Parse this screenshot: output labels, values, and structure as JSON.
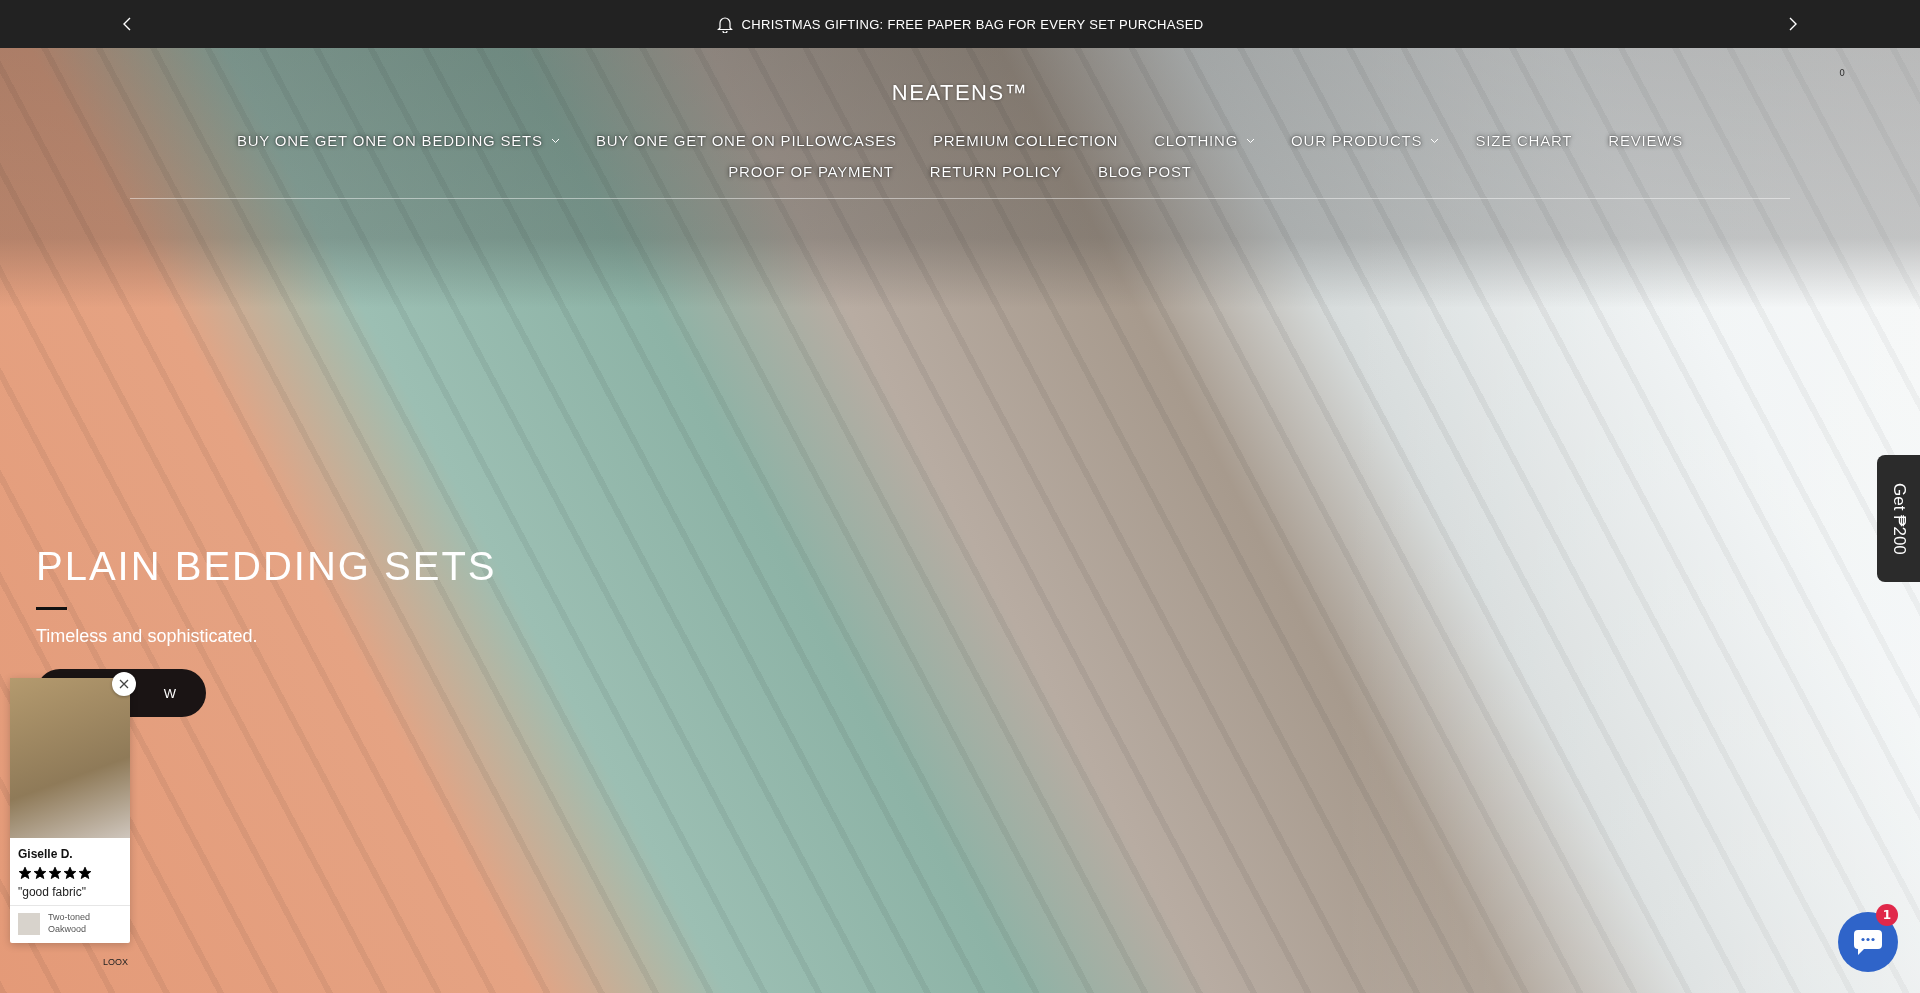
{
  "announcement": {
    "text": "CHRISTMAS GIFTING: FREE PAPER BAG FOR EVERY SET PURCHASED"
  },
  "header": {
    "logo": "NEATENS™",
    "cart_count": "0"
  },
  "nav": [
    {
      "label": "BUY ONE GET ONE ON BEDDING SETS",
      "has_dropdown": true
    },
    {
      "label": "BUY ONE GET ONE ON PILLOWCASES",
      "has_dropdown": false
    },
    {
      "label": "PREMIUM COLLECTION",
      "has_dropdown": false
    },
    {
      "label": "CLOTHING",
      "has_dropdown": true
    },
    {
      "label": "OUR PRODUCTS",
      "has_dropdown": true
    },
    {
      "label": "SIZE CHART",
      "has_dropdown": false
    },
    {
      "label": "REVIEWS",
      "has_dropdown": false
    },
    {
      "label": "PROOF OF PAYMENT",
      "has_dropdown": false
    },
    {
      "label": "RETURN POLICY",
      "has_dropdown": false
    },
    {
      "label": "BLOG POST",
      "has_dropdown": false
    }
  ],
  "hero": {
    "title": "PLAIN BEDDING SETS",
    "subtitle": "Timeless and sophisticated.",
    "button": "W"
  },
  "review_popup": {
    "name": "Giselle D.",
    "stars": 5,
    "quote": "\"good fabric\"",
    "product": "Two-toned Oakwood",
    "brand": "LOOX"
  },
  "side_tab": {
    "label": "Get ₱200"
  },
  "chat": {
    "badge": "1"
  }
}
